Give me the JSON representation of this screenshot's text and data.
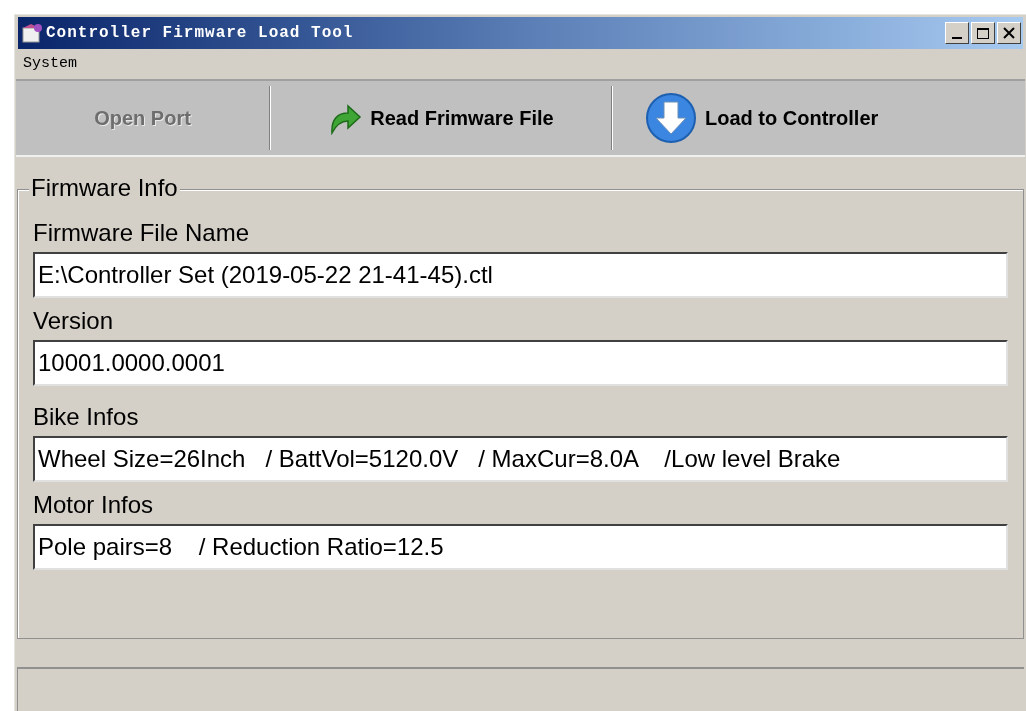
{
  "window": {
    "title": "Controller Firmware Load Tool"
  },
  "menu": [
    "System"
  ],
  "toolbar": [
    {
      "kind": "plain",
      "label": "Open Port",
      "disabled": true
    },
    {
      "kind": "read",
      "label": "Read Frimware File",
      "disabled": false
    },
    {
      "kind": "load",
      "label": "Load to Controller",
      "disabled": false
    }
  ],
  "group": {
    "title": "Firmware Info",
    "fields": [
      {
        "label": "Firmware File Name",
        "value": "E:\\Controller Set (2019-05-22 21-41-45).ctl"
      },
      {
        "label": "Version",
        "value": "10001.0000.0001"
      },
      {
        "label": "Bike Infos",
        "value": "Wheel Size=26Inch   / BattVol=5120.0V   / MaxCur=8.0A    /Low level Brake"
      },
      {
        "label": "Motor Infos",
        "value": "Pole pairs=8    / Reduction Ratio=12.5"
      }
    ]
  }
}
